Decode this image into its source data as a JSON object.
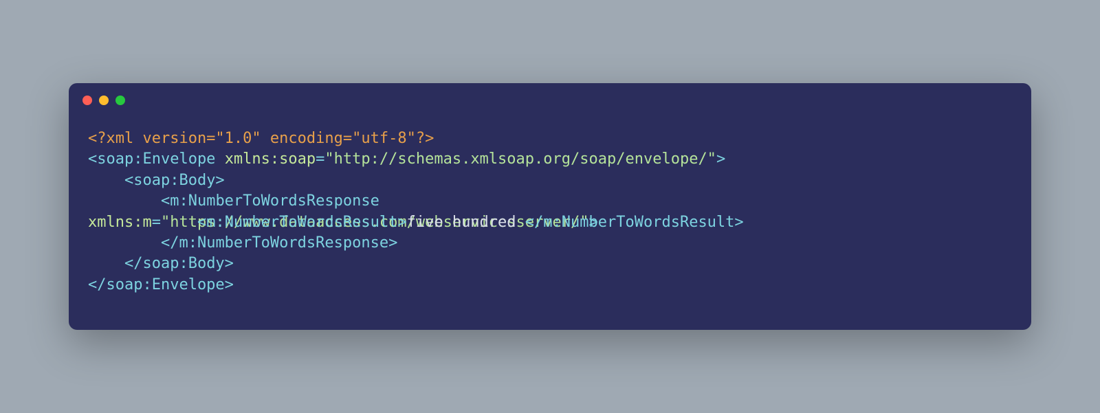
{
  "window": {
    "dots": [
      "red",
      "yellow",
      "green"
    ]
  },
  "code": {
    "line1": {
      "text": "<?xml version=\"1.0\" encoding=\"utf-8\"?>"
    },
    "line2": {
      "tagOpen": "<soap:Envelope",
      "space": " ",
      "attrName": "xmlns:soap",
      "eq": "=",
      "attrVal": "\"http://schemas.xmlsoap.org/soap/envelope/\"",
      "tagClose": ">"
    },
    "line3": {
      "indent": "    ",
      "tag": "<soap:Body>"
    },
    "line4": {
      "indent": "        ",
      "tag": "<m:NumberToWordsResponse"
    },
    "line5a": {
      "pre": "xmlns:m",
      "eq": "=",
      "valOpen": "\"",
      "valBody": "https://www.dataaccess.com/webservicesserver/",
      "valClose": "\"",
      "tagClose": ">"
    },
    "line5b": {
      "indent": "            ",
      "openTag": "<m:NumberToWordsResult>",
      "text": "five hundred ",
      "closeTag": "</m:NumberToWordsResult>"
    },
    "line6": {
      "indent": "        ",
      "tag": "</m:NumberToWordsResponse>"
    },
    "line7": {
      "indent": "    ",
      "tag": "</soap:Body>"
    },
    "line8": {
      "tag": "</soap:Envelope>"
    }
  }
}
